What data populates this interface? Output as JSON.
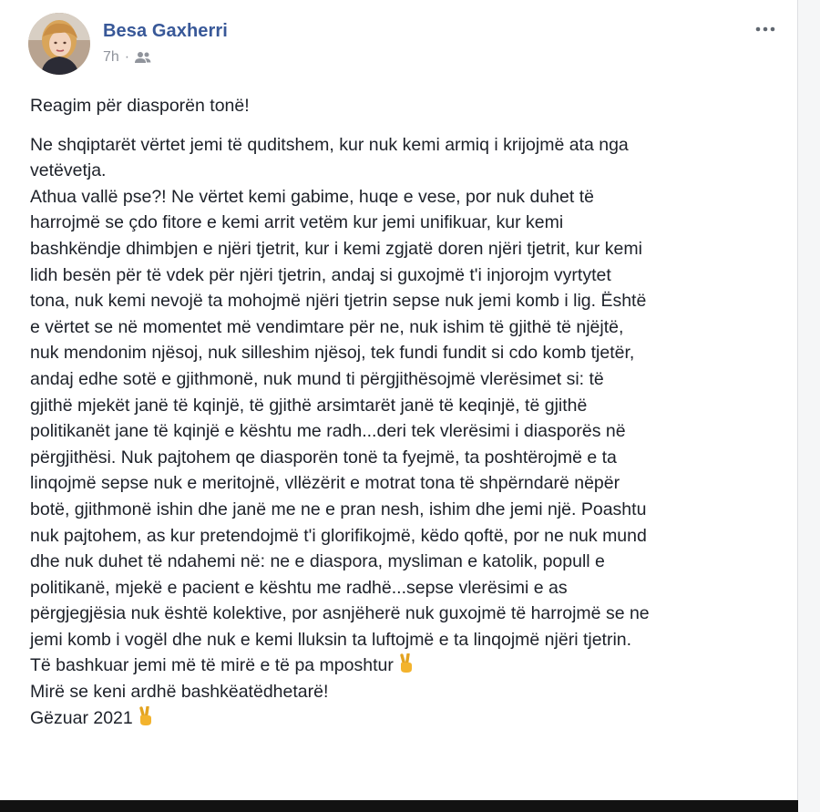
{
  "post": {
    "author": "Besa Gaxherri",
    "time": "7h",
    "separator": "·",
    "audience_icon": "friends-icon",
    "more_icon": "more-horizontal-icon",
    "title": "Reagim për diasporën tonë!",
    "paragraph_main": "Ne shqiptarët vërtet jemi të quditshem, kur nuk kemi armiq i krijojmë ata nga\nvetëvetja.\nAthua vallë pse?! Ne vërtet kemi gabime, huqe e vese, por nuk duhet të\nharrojmë se çdo fitore e kemi arrit vetëm kur jemi unifikuar, kur kemi\nbashkëndje dhimbjen e njëri tjetrit, kur i kemi zgjatë doren njëri tjetrit, kur kemi\nlidh besën për të vdek për njëri tjetrin, andaj si guxojmë t'i injorojm vyrtytet\ntona, nuk kemi nevojë ta mohojmë njëri tjetrin sepse nuk jemi komb i lig. Është\ne vërtet se në momentet më vendimtare për ne, nuk ishim të gjithë të njëjtë,\nnuk mendonim njësoj, nuk silleshim njësoj, tek fundi fundit si cdo komb tjetër,\nandaj edhe sotë e gjithmonë, nuk mund ti përgjithësojmë vlerësimet si: të\ngjithë mjekët janë të kqinjë, të gjithë arsimtarët janë të keqinjë, të gjithë\npolitikanët jane të kqinjë e kështu me radh...deri tek vlerësimi i diasporës në\npërgjithësi. Nuk pajtohem qe diasporën tonë ta fyejmë, ta poshtërojmë e ta\nlinqojmë sepse nuk e meritojnë, vllëzërit e motrat tona të shpërndarë nëpër\nbotë, gjithmonë ishin dhe janë me ne e pran nesh, ishim dhe jemi një. Poashtu\nnuk pajtohem, as kur pretendojmë t'i glorifikojmë, këdo qoftë, por ne nuk mund\ndhe nuk duhet të ndahemi në: ne e diaspora, mysliman e katolik, popull e\npolitikanë, mjekë e pacient e kështu me radhë...sepse vlerësimi e as\npërgjegjësia nuk është kolektive, por asnjëherë nuk guxojmë të harrojmë se ne\njemi komb i vogël dhe nuk e kemi lluksin ta luftojmë e ta linqojmë njëri tjetrin.",
    "line_together": "Të bashkuar jemi më të mirë e të pa mposhtur",
    "line_welcome": "Mirë se keni ardhë bashkëatëdhetarë!",
    "line_new_year": "Gëzuar 2021",
    "emoji_icon": "victory-hand-icon"
  },
  "colors": {
    "author": "#385898",
    "meta": "#90949c",
    "text": "#1d2129",
    "emoji": "#f3b32d",
    "page_bg": "#e9ebee"
  }
}
